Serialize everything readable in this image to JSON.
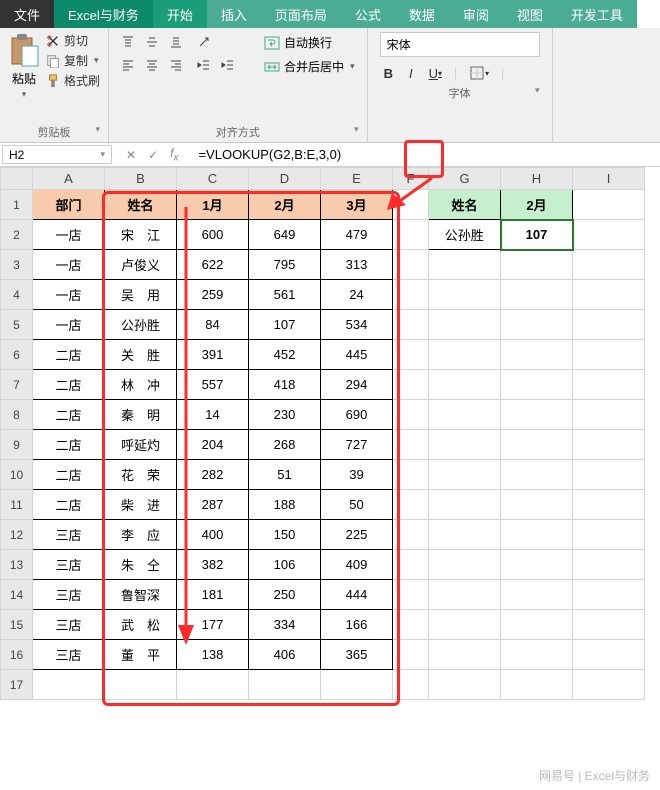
{
  "tabs": {
    "file": "文件",
    "addin": "Excel与财务",
    "home": "开始",
    "insert": "插入",
    "layout": "页面布局",
    "formulas": "公式",
    "data": "数据",
    "review": "审阅",
    "view": "视图",
    "dev": "开发工具"
  },
  "ribbon": {
    "clipboard": {
      "paste": "粘贴",
      "cut": "剪切",
      "copy": "复制",
      "format": "格式刷",
      "label": "剪贴板"
    },
    "align": {
      "wrap": "自动换行",
      "merge": "合并后居中",
      "label": "对齐方式"
    },
    "font": {
      "name": "宋体",
      "label": "字体",
      "bold": "B",
      "italic": "I",
      "underline": "U"
    }
  },
  "namebox": "H2",
  "formula": "=VLOOKUP(G2,B:E,3,0)",
  "formula_hl": "B:E",
  "cols": [
    "A",
    "B",
    "C",
    "D",
    "E",
    "F",
    "G",
    "H",
    "I"
  ],
  "headersMain": [
    "部门",
    "姓名",
    "1月",
    "2月",
    "3月"
  ],
  "headersLookup": [
    "姓名",
    "2月"
  ],
  "lookup": {
    "name": "公孙胜",
    "val": "107"
  },
  "rows": [
    {
      "dept": "一店",
      "name": "宋　江",
      "m1": "600",
      "m2": "649",
      "m3": "479"
    },
    {
      "dept": "一店",
      "name": "卢俊义",
      "m1": "622",
      "m2": "795",
      "m3": "313"
    },
    {
      "dept": "一店",
      "name": "吴　用",
      "m1": "259",
      "m2": "561",
      "m3": "24"
    },
    {
      "dept": "一店",
      "name": "公孙胜",
      "m1": "84",
      "m2": "107",
      "m3": "534"
    },
    {
      "dept": "二店",
      "name": "关　胜",
      "m1": "391",
      "m2": "452",
      "m3": "445"
    },
    {
      "dept": "二店",
      "name": "林　冲",
      "m1": "557",
      "m2": "418",
      "m3": "294"
    },
    {
      "dept": "二店",
      "name": "秦　明",
      "m1": "14",
      "m2": "230",
      "m3": "690"
    },
    {
      "dept": "二店",
      "name": "呼延灼",
      "m1": "204",
      "m2": "268",
      "m3": "727"
    },
    {
      "dept": "二店",
      "name": "花　荣",
      "m1": "282",
      "m2": "51",
      "m3": "39"
    },
    {
      "dept": "二店",
      "name": "柴　进",
      "m1": "287",
      "m2": "188",
      "m3": "50"
    },
    {
      "dept": "三店",
      "name": "李　应",
      "m1": "400",
      "m2": "150",
      "m3": "225"
    },
    {
      "dept": "三店",
      "name": "朱　仝",
      "m1": "382",
      "m2": "106",
      "m3": "409"
    },
    {
      "dept": "三店",
      "name": "鲁智深",
      "m1": "181",
      "m2": "250",
      "m3": "444"
    },
    {
      "dept": "三店",
      "name": "武　松",
      "m1": "177",
      "m2": "334",
      "m3": "166"
    },
    {
      "dept": "三店",
      "name": "董　平",
      "m1": "138",
      "m2": "406",
      "m3": "365"
    }
  ],
  "watermark": "网易号 | Excel与财务"
}
